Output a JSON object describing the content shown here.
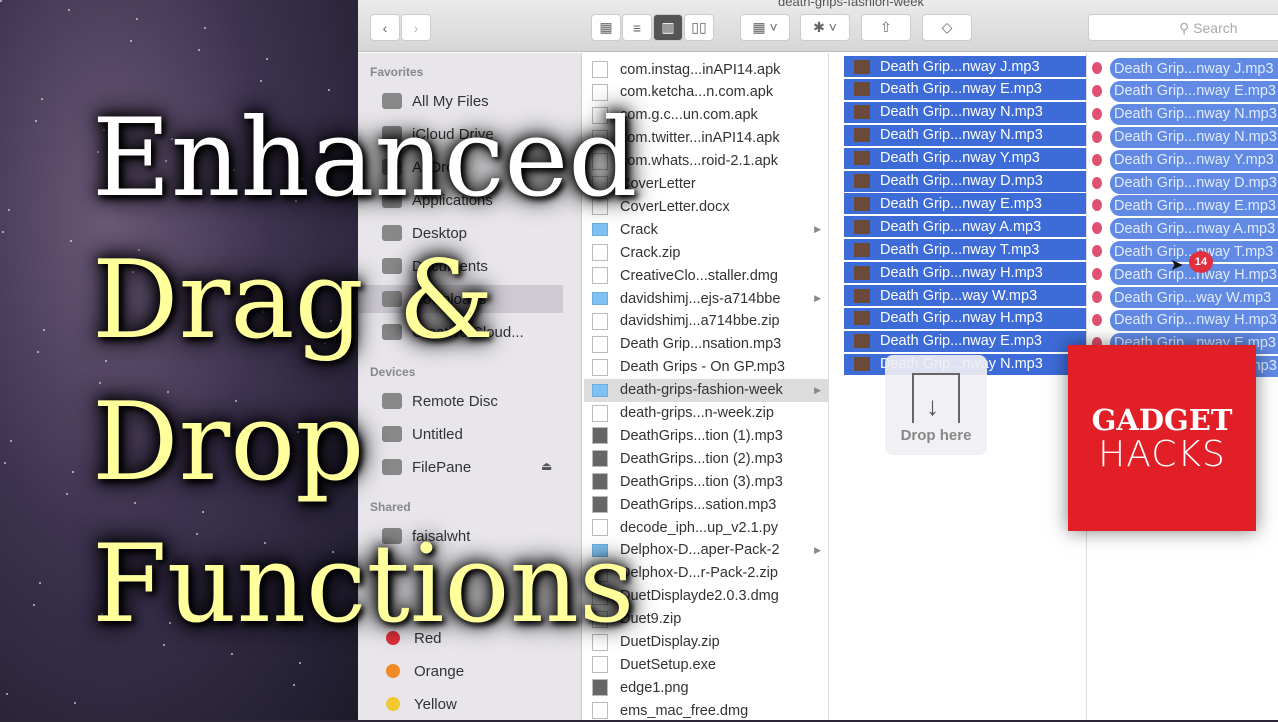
{
  "window": {
    "title": "death-grips-fashion-week",
    "search_placeholder": "Search"
  },
  "toolbar": {
    "back": "‹",
    "forward": "›",
    "icon_view": "▦",
    "list_view": "≡",
    "column_view": "▥",
    "cover_flow": "▯▯",
    "arrange": "▦ ˅",
    "action": "✱ ˅",
    "share": "⇧",
    "tags": "◇"
  },
  "sidebar": {
    "headers": {
      "favorites": "Favorites",
      "devices": "Devices",
      "shared": "Shared"
    },
    "favorites": [
      "All My Files",
      "iCloud Drive",
      "AirDrop",
      "Applications",
      "Desktop",
      "Documents",
      "Downloads",
      "Creative Cloud..."
    ],
    "devices": [
      "Remote Disc",
      "Untitled",
      "FilePane"
    ],
    "shared": [
      "faisalwht"
    ],
    "tags": [
      {
        "label": "Red",
        "color": "#e0303a"
      },
      {
        "label": "Orange",
        "color": "#f08a24"
      },
      {
        "label": "Yellow",
        "color": "#f0c830"
      }
    ]
  },
  "column1": [
    {
      "name": "com.instag...inAPI14.apk",
      "type": "file"
    },
    {
      "name": "com.ketcha...n.com.apk",
      "type": "file"
    },
    {
      "name": "com.g.c...un.com.apk",
      "type": "file"
    },
    {
      "name": "com.twitter...inAPI14.apk",
      "type": "file"
    },
    {
      "name": "com.whats...roid-2.1.apk",
      "type": "file"
    },
    {
      "name": "CoverLetter",
      "type": "file"
    },
    {
      "name": "CoverLetter.docx",
      "type": "file"
    },
    {
      "name": "Crack",
      "type": "folder"
    },
    {
      "name": "Crack.zip",
      "type": "file"
    },
    {
      "name": "CreativeClo...staller.dmg",
      "type": "file"
    },
    {
      "name": "davidshimj...ejs-a714bbe",
      "type": "folder"
    },
    {
      "name": "davidshimj...a714bbe.zip",
      "type": "file"
    },
    {
      "name": "Death Grip...nsation.mp3",
      "type": "file"
    },
    {
      "name": "Death Grips - On GP.mp3",
      "type": "file"
    },
    {
      "name": "death-grips-fashion-week",
      "type": "folder",
      "selected": true
    },
    {
      "name": "death-grips...n-week.zip",
      "type": "file"
    },
    {
      "name": "DeathGrips...tion (1).mp3",
      "type": "media"
    },
    {
      "name": "DeathGrips...tion (2).mp3",
      "type": "media"
    },
    {
      "name": "DeathGrips...tion (3).mp3",
      "type": "media"
    },
    {
      "name": "DeathGrips...sation.mp3",
      "type": "media"
    },
    {
      "name": "decode_iph...up_v2.1.py",
      "type": "file"
    },
    {
      "name": "Delphox-D...aper-Pack-2",
      "type": "folder"
    },
    {
      "name": "Delphox-D...r-Pack-2.zip",
      "type": "file"
    },
    {
      "name": "DuetDisplayde2.0.3.dmg",
      "type": "file"
    },
    {
      "name": "Duet9.zip",
      "type": "file"
    },
    {
      "name": "DuetDisplay.zip",
      "type": "file"
    },
    {
      "name": "DuetSetup.exe",
      "type": "file"
    },
    {
      "name": "edge1.png",
      "type": "media"
    },
    {
      "name": "ems_mac_free.dmg",
      "type": "file"
    }
  ],
  "column2": [
    "Death Grip...nway J.mp3",
    "Death Grip...nway E.mp3",
    "Death Grip...nway N.mp3",
    "Death Grip...nway N.mp3",
    "Death Grip...nway Y.mp3",
    "Death Grip...nway D.mp3",
    "Death Grip...nway E.mp3",
    "Death Grip...nway A.mp3",
    "Death Grip...nway T.mp3",
    "Death Grip...nway H.mp3",
    "Death Grip...way W.mp3",
    "Death Grip...nway H.mp3",
    "Death Grip...nway E.mp3",
    "Death Grip...nway N.mp3"
  ],
  "drag": {
    "count": "14",
    "drop_label": "Drop here"
  },
  "overlay": {
    "line1": "Enhanced",
    "line2": "Drag &",
    "line3": "Drop",
    "line4": "Functions"
  },
  "logo": {
    "line1": "GADGET",
    "line2": "HACKS",
    "color": "#e21f26"
  },
  "colors": {
    "selection": "#3d6bd8",
    "title_white": "#ffffff",
    "title_yellow": "#ffff9c"
  }
}
